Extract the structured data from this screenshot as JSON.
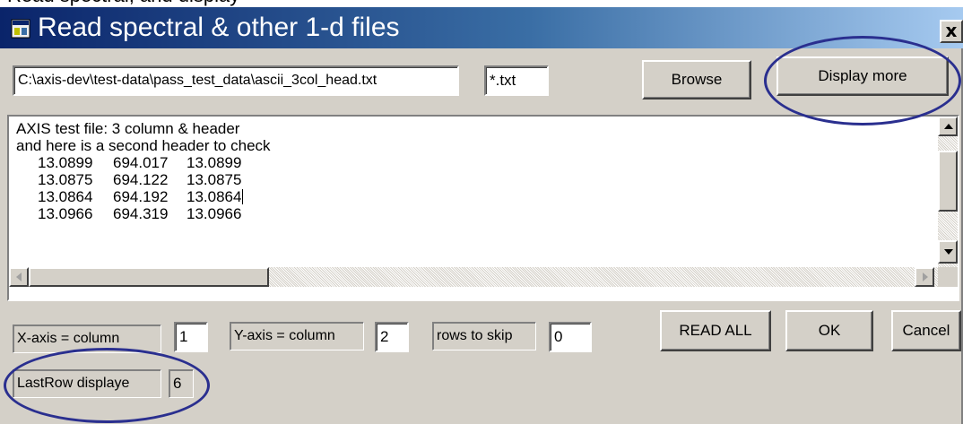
{
  "top_strip": {
    "text": "Read spectral, and display"
  },
  "window": {
    "title": "Read spectral & other 1-d files",
    "close_glyph": "x",
    "icon": "app-window-icon"
  },
  "file": {
    "path": "C:\\axis-dev\\test-data\\pass_test_data\\ascii_3col_head.txt",
    "filter": "*.txt"
  },
  "buttons": {
    "browse": "Browse",
    "display_more": "Display more",
    "read_all": "READ ALL",
    "ok": "OK",
    "cancel": "Cancel"
  },
  "text_area": {
    "header_lines": [
      "AXIS test file: 3 column & header",
      "and here is a second header to check"
    ],
    "rows": [
      [
        "13.0899",
        "694.017",
        "13.0899"
      ],
      [
        "13.0875",
        "694.122",
        "13.0875"
      ],
      [
        "13.0864",
        "694.192",
        "13.0864"
      ],
      [
        "13.0966",
        "694.319",
        "13.0966"
      ]
    ]
  },
  "params": {
    "x_axis_label": "X-axis = column",
    "x_axis_value": "1",
    "y_axis_label": "Y-axis = column",
    "y_axis_value": "2",
    "rows_skip_label": "rows to skip",
    "rows_skip_value": "0",
    "last_row_label": "LastRow displaye",
    "last_row_value": "6"
  },
  "colors": {
    "titlebar_start": "#0a246a",
    "titlebar_end": "#a6caf0",
    "annotation_ellipse": "#2a2f8f",
    "dialog_face": "#d4d0c8"
  }
}
